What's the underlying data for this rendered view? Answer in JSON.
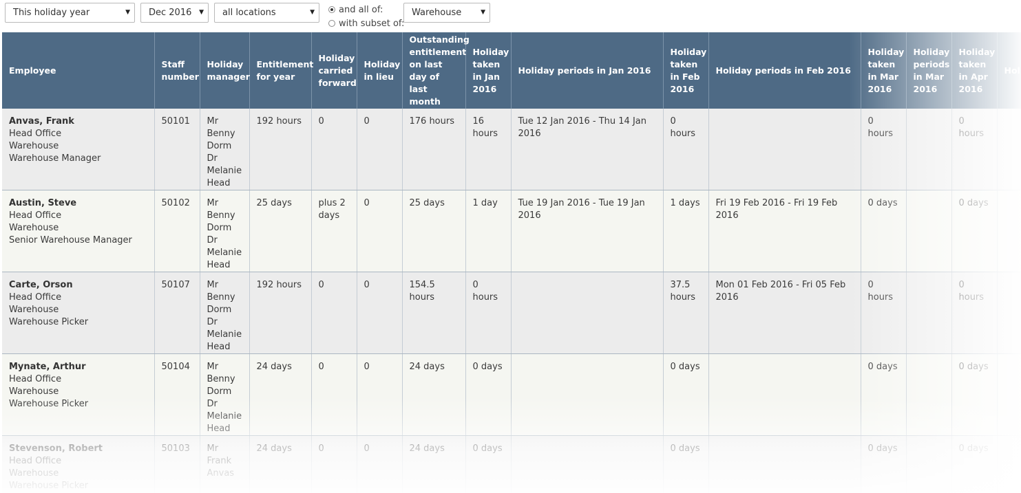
{
  "filters": {
    "period": "This holiday year",
    "month": "Dec 2016",
    "location": "all locations",
    "match_all_label": "and all of:",
    "match_subset_label": "with subset of:",
    "group": "Warehouse"
  },
  "columns": [
    "Employee",
    "Staff number",
    "Holiday manager",
    "Entitlement for year",
    "Holiday carried forward",
    "Holiday in lieu",
    "Outstanding entitlement on last day of last month",
    "Holiday taken in Jan 2016",
    "Holiday periods in Jan 2016",
    "Holiday taken in Feb 2016",
    "Holiday periods in Feb 2016",
    "Holiday taken in Mar 2016",
    "Holiday periods in Mar 2016",
    "Holiday taken in Apr 2016",
    "Holi..."
  ],
  "rows": [
    {
      "name": "Anvas, Frank",
      "office": "Head Office",
      "location": "Warehouse",
      "role": "Warehouse Manager",
      "staff_number": "50101",
      "manager": "Mr Benny Dorm Dr Melanie Head",
      "entitlement": "192 hours",
      "carried": "0",
      "lieu": "0",
      "outstanding": "176 hours",
      "jan_taken": "16 hours",
      "jan_periods": "Tue 12 Jan 2016 - Thu 14 Jan 2016",
      "feb_taken": "0 hours",
      "feb_periods": "",
      "mar_taken": "0 hours",
      "mar_periods": "",
      "apr_taken": "0 hours"
    },
    {
      "name": "Austin, Steve",
      "office": "Head Office",
      "location": "Warehouse",
      "role": "Senior Warehouse Manager",
      "staff_number": "50102",
      "manager": "Mr Benny Dorm Dr Melanie Head",
      "entitlement": "25 days",
      "carried": "plus 2 days",
      "lieu": "0",
      "outstanding": "25 days",
      "jan_taken": "1 day",
      "jan_periods": "Tue 19 Jan 2016 - Tue 19 Jan 2016",
      "feb_taken": "1 days",
      "feb_periods": "Fri 19 Feb 2016 - Fri 19 Feb 2016",
      "mar_taken": "0 days",
      "mar_periods": "",
      "apr_taken": "0 days"
    },
    {
      "name": "Carte, Orson",
      "office": "Head Office",
      "location": "Warehouse",
      "role": "Warehouse Picker",
      "staff_number": "50107",
      "manager": "Mr Benny Dorm Dr Melanie Head",
      "entitlement": "192 hours",
      "carried": "0",
      "lieu": "0",
      "outstanding": "154.5 hours",
      "jan_taken": "0 hours",
      "jan_periods": "",
      "feb_taken": "37.5 hours",
      "feb_periods": "Mon 01 Feb 2016 - Fri 05 Feb 2016",
      "mar_taken": "0 hours",
      "mar_periods": "",
      "apr_taken": "0 hours"
    },
    {
      "name": "Mynate, Arthur",
      "office": "Head Office",
      "location": "Warehouse",
      "role": "Warehouse Picker",
      "staff_number": "50104",
      "manager": "Mr Benny Dorm Dr Melanie Head",
      "entitlement": "24 days",
      "carried": "0",
      "lieu": "0",
      "outstanding": "24 days",
      "jan_taken": "0 days",
      "jan_periods": "",
      "feb_taken": "0 days",
      "feb_periods": "",
      "mar_taken": "0 days",
      "mar_periods": "",
      "apr_taken": "0 days"
    },
    {
      "name": "Stevenson, Robert",
      "office": "Head Office",
      "location": "Warehouse",
      "role": "Warehouse Picker",
      "staff_number": "50103",
      "manager": "Mr Frank Anvas",
      "entitlement": "24 days",
      "carried": "0",
      "lieu": "0",
      "outstanding": "24 days",
      "jan_taken": "0 days",
      "jan_periods": "",
      "feb_taken": "0 days",
      "feb_periods": "",
      "mar_taken": "0 days",
      "mar_periods": "",
      "apr_taken": "0 days"
    }
  ]
}
